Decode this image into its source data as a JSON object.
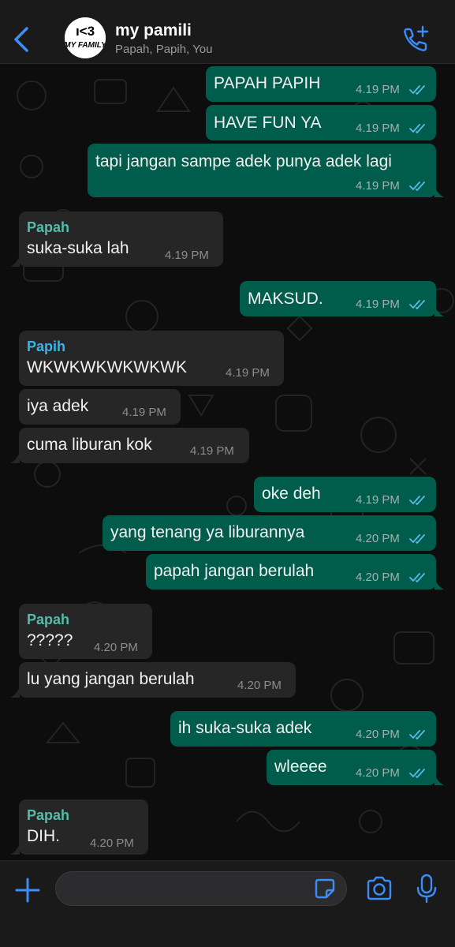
{
  "header": {
    "title": "my pamili",
    "subtitle": "Papah, Papih, You",
    "avatar_text_top": "ı<3",
    "avatar_text_bottom": "MY FAMILY"
  },
  "colors": {
    "outgoing_bubble": "#005c4b",
    "incoming_bubble": "#262626",
    "accent_blue": "#53bdeb",
    "sender_papah": "#53bdaa",
    "sender_papih": "#35b5ea"
  },
  "messages": [
    {
      "dir": "out",
      "text": "PAPAH PAPIH",
      "time": "4.19 PM"
    },
    {
      "dir": "out",
      "text": "HAVE FUN YA",
      "time": "4.19 PM"
    },
    {
      "dir": "out",
      "text": "tapi jangan sampe adek punya adek lagi",
      "time": "4.19 PM"
    },
    {
      "dir": "in",
      "sender": "Papah",
      "text": "suka-suka lah",
      "time": "4.19 PM"
    },
    {
      "dir": "out",
      "text": "MAKSUD.",
      "time": "4.19 PM"
    },
    {
      "dir": "in",
      "sender": "Papih",
      "text": "WKWKWKWKWKWK",
      "time": "4.19 PM"
    },
    {
      "dir": "in",
      "text": "iya adek",
      "time": "4.19 PM"
    },
    {
      "dir": "in",
      "text": "cuma liburan kok",
      "time": "4.19 PM"
    },
    {
      "dir": "out",
      "text": "oke deh",
      "time": "4.19 PM"
    },
    {
      "dir": "out",
      "text": "yang tenang ya liburannya",
      "time": "4.20 PM"
    },
    {
      "dir": "out",
      "text": "papah jangan berulah",
      "time": "4.20 PM"
    },
    {
      "dir": "in",
      "sender": "Papah",
      "text": "?????",
      "time": "4.20 PM"
    },
    {
      "dir": "in",
      "text": "lu yang jangan berulah",
      "time": "4.20 PM"
    },
    {
      "dir": "out",
      "text": "ih suka-suka adek",
      "time": "4.20 PM"
    },
    {
      "dir": "out",
      "text": "wleeee",
      "time": "4.20 PM"
    },
    {
      "dir": "in",
      "sender": "Papah",
      "text": "DIH.",
      "time": "4.20 PM"
    }
  ],
  "composer": {
    "input_value": "",
    "input_placeholder": ""
  }
}
